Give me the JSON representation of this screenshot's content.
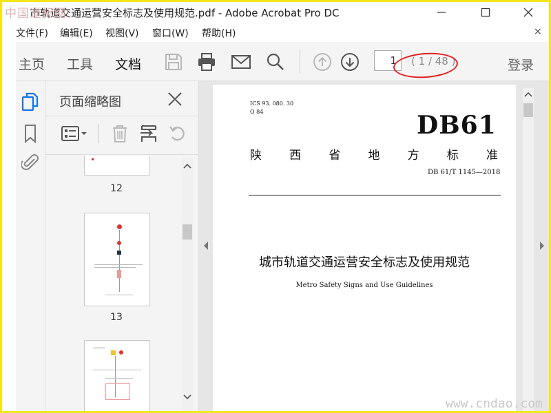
{
  "window": {
    "title": "市轨道交通运营安全标志及使用规范.pdf - Adobe Acrobat Pro DC",
    "watermark": "中国道标网"
  },
  "menu": {
    "items": [
      "文件(F)",
      "编辑(E)",
      "视图(V)",
      "窗口(W)",
      "帮助(H)"
    ],
    "close_glyph": "×"
  },
  "toolbar": {
    "tabs": [
      "主页",
      "工具",
      "文档"
    ],
    "active_tab": "文档",
    "page_current": "1",
    "page_count": "( 1 / 48 )",
    "login": "登录"
  },
  "thumbnails": {
    "title": "页面缩略图",
    "pages": [
      "12",
      "13"
    ]
  },
  "document": {
    "ics": "ICS   93. 080. 30",
    "class": "Q 84",
    "code": "DB61",
    "standard_chars": [
      "陕",
      "西",
      "省",
      "地",
      "方",
      "标",
      "准"
    ],
    "number": "DB 61/T 1145—2018",
    "title_cn": "城市轨道交通运营安全标志及使用规范",
    "title_en": "Metro Safety Signs and Use Guidelines"
  },
  "site_watermark": "www.cndao.com",
  "colors": {
    "frame": "#f4e61c",
    "accent": "#1473e6",
    "annotation": "#e02020"
  }
}
